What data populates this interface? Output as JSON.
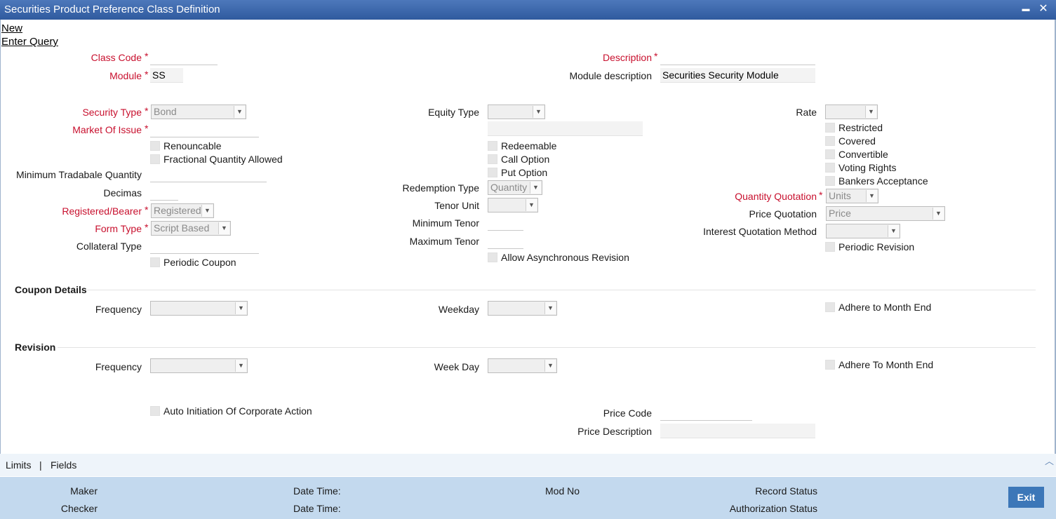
{
  "window": {
    "title": "Securities Product Preference Class Definition",
    "minimize": "▬",
    "close": "✕"
  },
  "actions": {
    "new": "New",
    "enter_query": "Enter Query"
  },
  "header": {
    "class_code_label": "Class Code",
    "class_code_value": "",
    "module_label": "Module",
    "module_value": "SS",
    "description_label": "Description",
    "description_value": "",
    "module_desc_label": "Module description",
    "module_desc_value": "Securities Security Module",
    "required_mark": "*"
  },
  "left": {
    "security_type_label": "Security Type",
    "security_type_value": "Bond",
    "market_of_issue_label": "Market Of Issue",
    "market_of_issue_value": "",
    "renouncable": "Renouncable",
    "fractional_quantity": "Fractional Quantity Allowed",
    "min_tradable_qty_label": "Minimum Tradabale Quantity",
    "min_tradable_qty_value": "",
    "decimas_label": "Decimas",
    "decimas_value": "",
    "registered_bearer_label": "Registered/Bearer",
    "registered_bearer_value": "Registered",
    "form_type_label": "Form Type",
    "form_type_value": "Script Based",
    "collateral_type_label": "Collateral Type",
    "collateral_type_value": "",
    "periodic_coupon": "Periodic Coupon"
  },
  "middle": {
    "equity_type_label": "Equity Type",
    "equity_type_value": "",
    "equity_type_desc_value": "",
    "redeemable": "Redeemable",
    "call_option": "Call Option",
    "put_option": "Put Option",
    "redemption_type_label": "Redemption Type",
    "redemption_type_value": "Quantity",
    "tenor_unit_label": "Tenor Unit",
    "tenor_unit_value": "",
    "min_tenor_label": "Minimum Tenor",
    "min_tenor_value": "",
    "max_tenor_label": "Maximum Tenor",
    "max_tenor_value": "",
    "async_revision": "Allow Asynchronous Revision"
  },
  "right": {
    "rate_label": "Rate",
    "rate_value": "",
    "restricted": "Restricted",
    "covered": "Covered",
    "convertible": "Convertible",
    "voting_rights": "Voting Rights",
    "bankers_acceptance": "Bankers Acceptance",
    "quantity_quotation_label": "Quantity Quotation",
    "quantity_quotation_value": "Units",
    "price_quotation_label": "Price Quotation",
    "price_quotation_value": "Price",
    "interest_quotation_label": "Interest Quotation Method",
    "interest_quotation_value": "",
    "periodic_revision": "Periodic Revision"
  },
  "coupon": {
    "title": "Coupon Details",
    "frequency_label": "Frequency",
    "frequency_value": "",
    "weekday_label": "Weekday",
    "weekday_value": "",
    "adhere": "Adhere to Month End"
  },
  "revision": {
    "title": "Revision",
    "frequency_label": "Frequency",
    "frequency_value": "",
    "weekday_label": "Week Day",
    "weekday_value": "",
    "adhere": "Adhere To Month End"
  },
  "bottom": {
    "auto_initiation": "Auto Initiation Of Corporate Action",
    "price_code_label": "Price Code",
    "price_code_value": "",
    "price_desc_label": "Price Description",
    "price_desc_value": ""
  },
  "tabs": {
    "limits": "Limits",
    "separator": "|",
    "fields": "Fields",
    "scroll_up": "︿"
  },
  "footer": {
    "maker": "Maker",
    "checker": "Checker",
    "date_time_1": "Date Time:",
    "date_time_2": "Date Time:",
    "mod_no": "Mod No",
    "record_status": "Record Status",
    "authorization_status": "Authorization Status",
    "exit": "Exit"
  }
}
